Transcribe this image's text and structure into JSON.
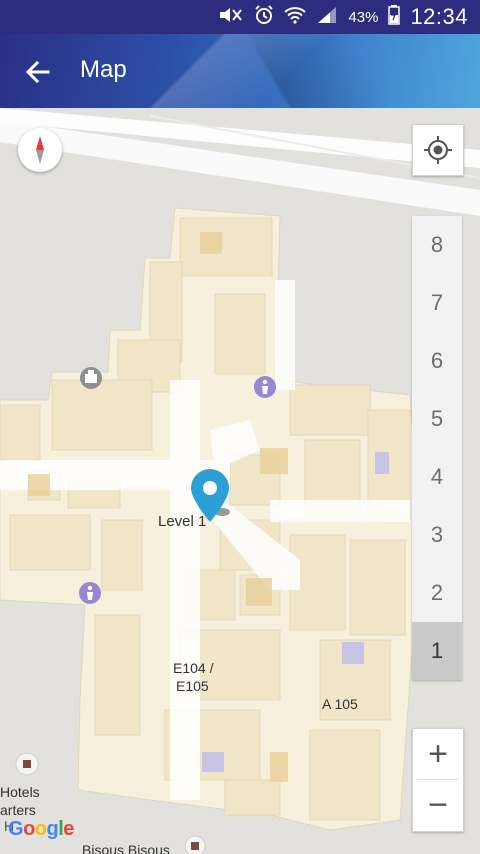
{
  "status_bar": {
    "battery": "43%",
    "time": "12:34"
  },
  "app_bar": {
    "title": "Map"
  },
  "map": {
    "current_level_label": "Level 1",
    "room_labels": [
      "E104 /",
      "E105",
      "A 105"
    ],
    "poi_labels": [
      "Hotels",
      "arters",
      "H",
      "Bisous Bisous"
    ],
    "google": "Google"
  },
  "floors": [
    "8",
    "7",
    "6",
    "5",
    "4",
    "3",
    "2",
    "1"
  ],
  "selected_floor": "1",
  "zoom": {
    "in": "+",
    "out": "−"
  }
}
